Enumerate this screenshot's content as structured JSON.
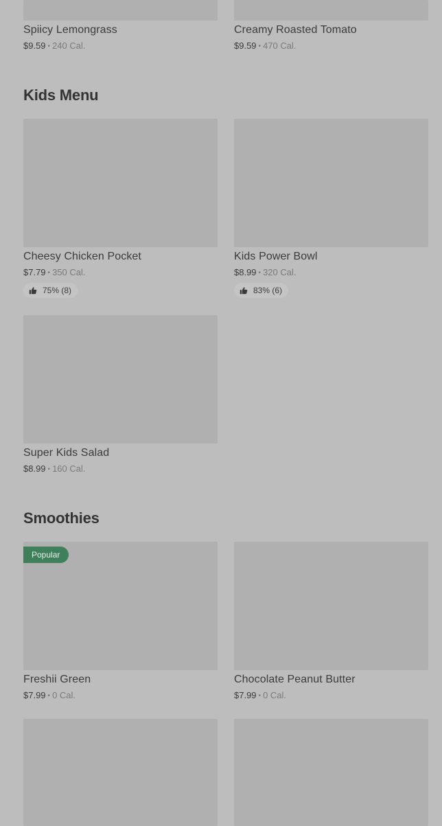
{
  "colors": {
    "background": "#bdbdbd",
    "image_placeholder": "#b0b0b0",
    "badge": "#3f7f5c",
    "rating_pill": "#c4c4c4"
  },
  "top_items": [
    {
      "name": "Spiicy Lemongrass",
      "price": "$9.59",
      "calories": "240 Cal."
    },
    {
      "name": "Creamy Roasted Tomato",
      "price": "$9.59",
      "calories": "470 Cal."
    }
  ],
  "sections": {
    "kids_menu": {
      "title": "Kids Menu",
      "items": [
        {
          "name": "Cheesy Chicken Pocket",
          "price": "$7.79",
          "calories": "350 Cal.",
          "rating": "75% (8)",
          "rating_icon": "thumbs-up-icon"
        },
        {
          "name": "Kids Power Bowl",
          "price": "$8.99",
          "calories": "320 Cal.",
          "rating": "83% (6)",
          "rating_icon": "thumbs-up-icon"
        },
        {
          "name": "Super Kids Salad",
          "price": "$8.99",
          "calories": "160 Cal."
        }
      ]
    },
    "smoothies": {
      "title": "Smoothies",
      "items": [
        {
          "name": "Freshii Green",
          "price": "$7.99",
          "calories": "0 Cal.",
          "badge": "Popular"
        },
        {
          "name": "Chocolate Peanut Butter",
          "price": "$7.99",
          "calories": "0 Cal."
        }
      ]
    }
  },
  "separator": "•"
}
